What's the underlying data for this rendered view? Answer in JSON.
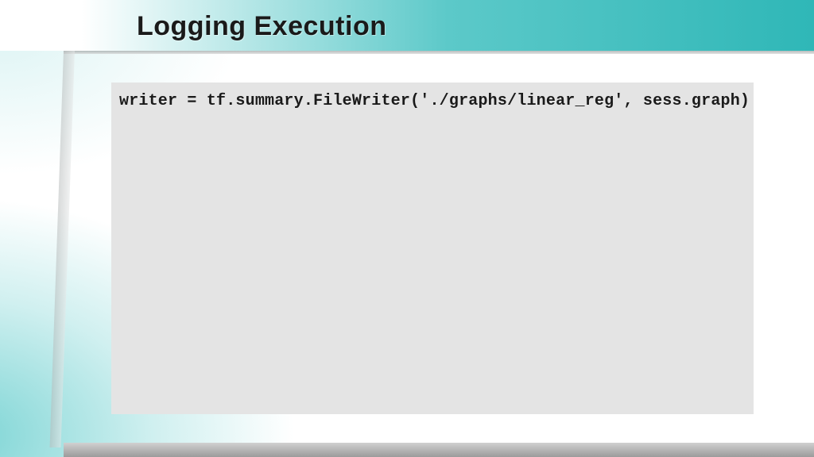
{
  "slide": {
    "title": "Logging Execution",
    "code": "writer = tf.summary.FileWriter('./graphs/linear_reg', sess.graph)"
  }
}
